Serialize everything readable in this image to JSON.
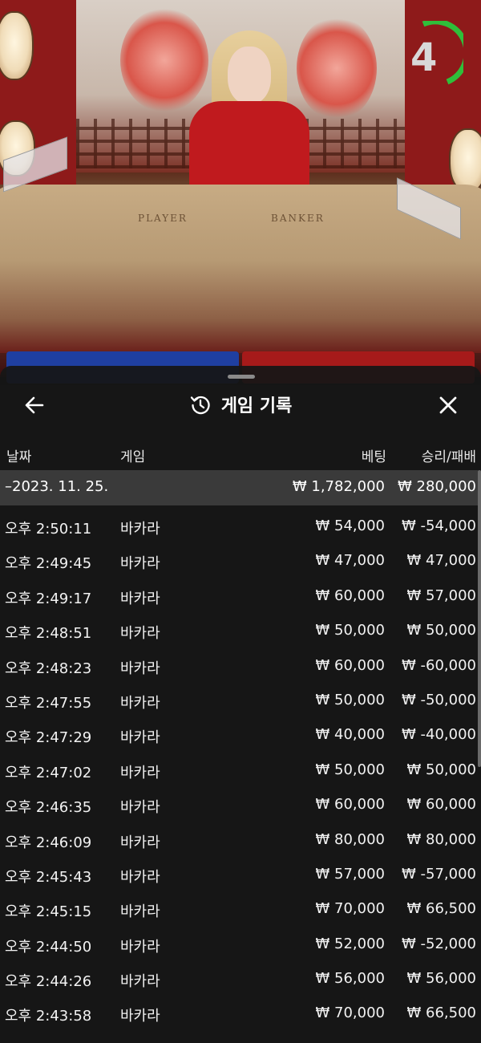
{
  "timer": {
    "value": "4",
    "color": "#2fbf3a"
  },
  "table": {
    "player_label": "PLAYER",
    "banker_label": "BANKER"
  },
  "sheet": {
    "title": "게임 기록",
    "icons": {
      "back": "arrow-left-icon",
      "history": "history-icon",
      "close": "close-icon"
    },
    "columns": {
      "date": "날짜",
      "game": "게임",
      "bet": "베팅",
      "win_loss": "승리/패배"
    },
    "day_summary": {
      "date": "–2023. 11. 25.",
      "bet": "₩ 1,782,000",
      "win_loss": "₩ 280,000"
    },
    "rows": [
      {
        "time": "오후 2:50:11",
        "game": "바카라",
        "bet": "₩ 54,000",
        "win_loss": "₩ -54,000"
      },
      {
        "time": "오후 2:49:45",
        "game": "바카라",
        "bet": "₩ 47,000",
        "win_loss": "₩ 47,000"
      },
      {
        "time": "오후 2:49:17",
        "game": "바카라",
        "bet": "₩ 60,000",
        "win_loss": "₩ 57,000"
      },
      {
        "time": "오후 2:48:51",
        "game": "바카라",
        "bet": "₩ 50,000",
        "win_loss": "₩ 50,000"
      },
      {
        "time": "오후 2:48:23",
        "game": "바카라",
        "bet": "₩ 60,000",
        "win_loss": "₩ -60,000"
      },
      {
        "time": "오후 2:47:55",
        "game": "바카라",
        "bet": "₩ 50,000",
        "win_loss": "₩ -50,000"
      },
      {
        "time": "오후 2:47:29",
        "game": "바카라",
        "bet": "₩ 40,000",
        "win_loss": "₩ -40,000"
      },
      {
        "time": "오후 2:47:02",
        "game": "바카라",
        "bet": "₩ 50,000",
        "win_loss": "₩ 50,000"
      },
      {
        "time": "오후 2:46:35",
        "game": "바카라",
        "bet": "₩ 60,000",
        "win_loss": "₩ 60,000"
      },
      {
        "time": "오후 2:46:09",
        "game": "바카라",
        "bet": "₩ 80,000",
        "win_loss": "₩ 80,000"
      },
      {
        "time": "오후 2:45:43",
        "game": "바카라",
        "bet": "₩ 57,000",
        "win_loss": "₩ -57,000"
      },
      {
        "time": "오후 2:45:15",
        "game": "바카라",
        "bet": "₩ 70,000",
        "win_loss": "₩ 66,500"
      },
      {
        "time": "오후 2:44:50",
        "game": "바카라",
        "bet": "₩ 52,000",
        "win_loss": "₩ -52,000"
      },
      {
        "time": "오후 2:44:26",
        "game": "바카라",
        "bet": "₩ 56,000",
        "win_loss": "₩ 56,000"
      },
      {
        "time": "오후 2:43:58",
        "game": "바카라",
        "bet": "₩ 70,000",
        "win_loss": "₩ 66,500"
      }
    ]
  }
}
